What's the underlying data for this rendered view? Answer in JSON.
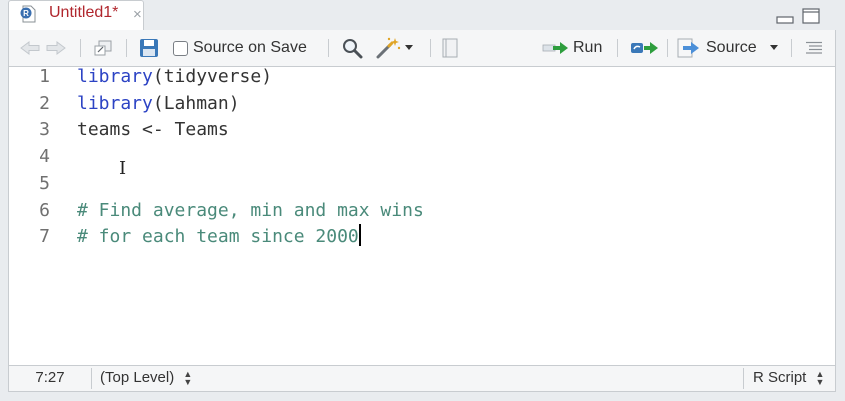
{
  "tab": {
    "title": "Untitled1*",
    "close_glyph": "×",
    "icon": "r-file-icon"
  },
  "toolbar": {
    "source_on_save_label": "Source on Save",
    "source_on_save_checked": false,
    "run_label": "Run",
    "source_label": "Source"
  },
  "editor": {
    "line_numbers": [
      "1",
      "2",
      "3",
      "4",
      "5",
      "6",
      "7"
    ],
    "lines": {
      "l1_fn": "library",
      "l1_rest": "(tidyverse)",
      "l2_fn": "library",
      "l2_rest": "(Lahman)",
      "l3": "teams <- Teams",
      "l4": "",
      "l5": "",
      "l6": "# Find average, min and max wins",
      "l7": "# for each team since 2000"
    },
    "ibeam_glyph": "I"
  },
  "status": {
    "position": "7:27",
    "scope": "(Top Level)",
    "file_type": "R Script",
    "updown_glyph_up": "▲",
    "updown_glyph_down": "▼"
  },
  "colors": {
    "tab_title": "#b0262d",
    "keyword": "#2c43c4",
    "comment": "#4a8a7a",
    "run_arrow": "#2e9e3e",
    "save_icon": "#3a78b8"
  }
}
